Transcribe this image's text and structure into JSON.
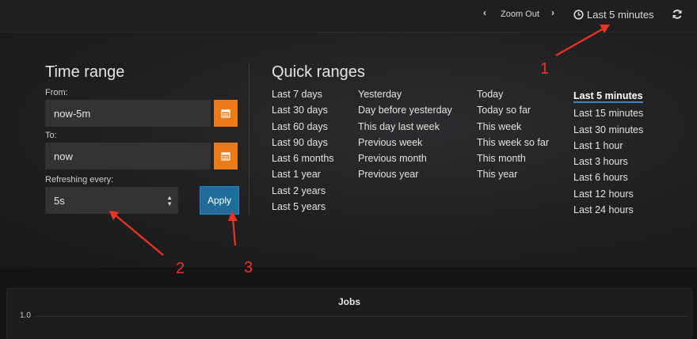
{
  "topbar": {
    "zoom_out": "Zoom Out",
    "time_label": "Last 5 minutes"
  },
  "time_range": {
    "title": "Time range",
    "from_label": "From:",
    "from_value": "now-5m",
    "to_label": "To:",
    "to_value": "now",
    "refresh_label": "Refreshing every:",
    "refresh_value": "5s",
    "apply_label": "Apply"
  },
  "quick_ranges": {
    "title": "Quick ranges",
    "col1": [
      "Last 7 days",
      "Last 30 days",
      "Last 60 days",
      "Last 90 days",
      "Last 6 months",
      "Last 1 year",
      "Last 2 years",
      "Last 5 years"
    ],
    "col2": [
      "Yesterday",
      "Day before yesterday",
      "This day last week",
      "Previous week",
      "Previous month",
      "Previous year"
    ],
    "col3": [
      "Today",
      "Today so far",
      "This week",
      "This week so far",
      "This month",
      "This year"
    ],
    "col4": [
      "Last 5 minutes",
      "Last 15 minutes",
      "Last 30 minutes",
      "Last 1 hour",
      "Last 3 hours",
      "Last 6 hours",
      "Last 12 hours",
      "Last 24 hours"
    ]
  },
  "graph": {
    "title": "Jobs",
    "y_tick": "1.0"
  },
  "annotations": [
    "1",
    "2",
    "3"
  ],
  "colors": {
    "accent_orange": "#eb7b18",
    "apply_blue": "#1f6c98",
    "active_underline": "#3b85c8",
    "annotation_red": "#ee3322"
  }
}
